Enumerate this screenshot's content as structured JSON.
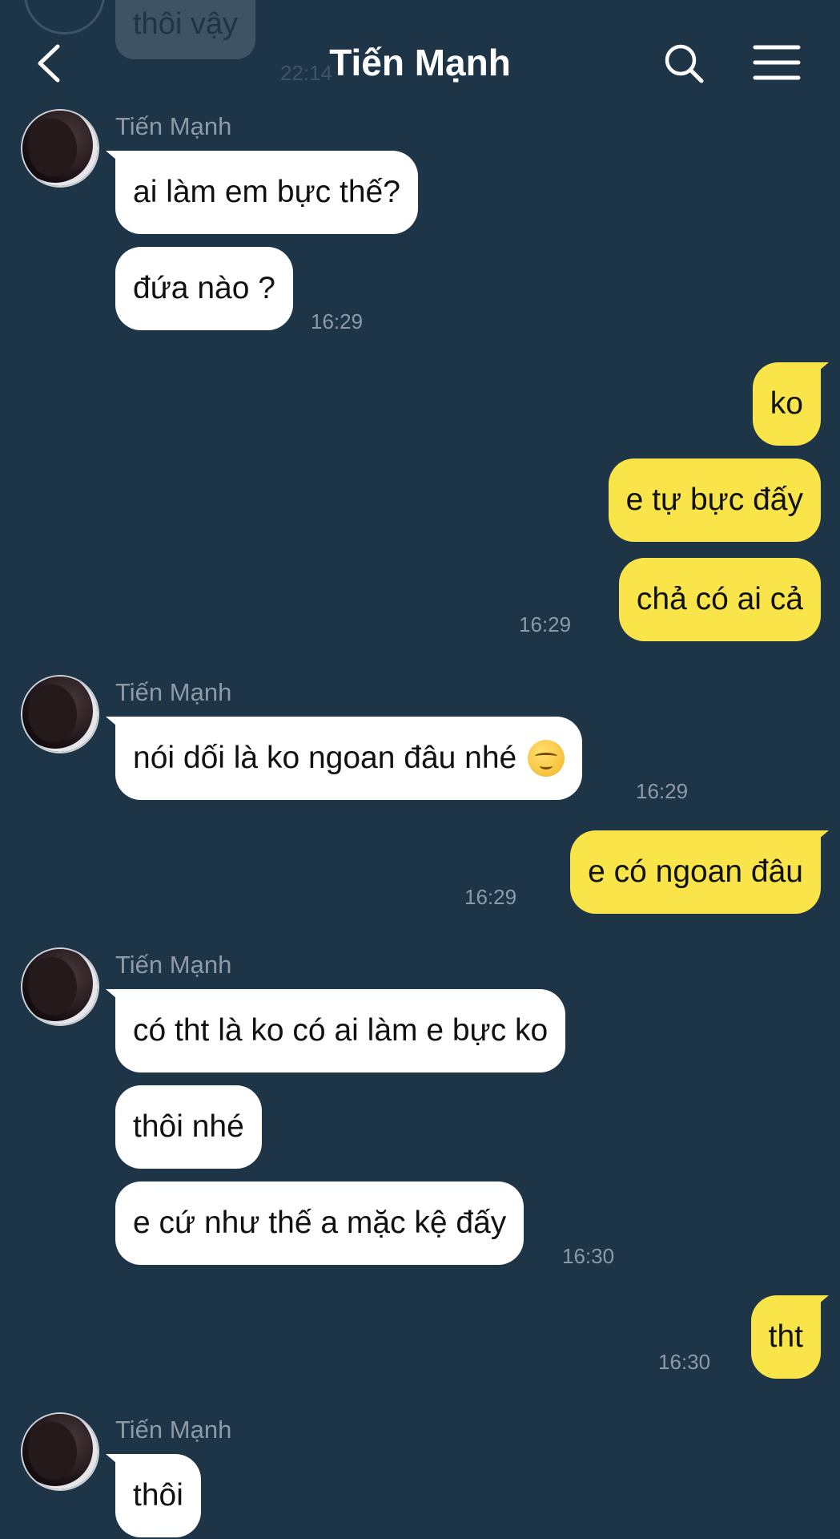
{
  "header": {
    "title": "Tiến Mạnh",
    "back_icon": "chevron-left-icon",
    "search_icon": "search-icon",
    "menu_icon": "hamburger-menu-icon"
  },
  "faded_top": {
    "text": "thôi vậy",
    "time": "22:14"
  },
  "colors": {
    "background": "#1e3447",
    "incoming_bubble": "#ffffff",
    "outgoing_bubble": "#f9e44a",
    "meta_text": "#8e9aa6"
  },
  "messages": [
    {
      "direction": "incoming",
      "sender": "Tiến Mạnh",
      "bubbles": [
        "ai làm em bực thế?",
        "đứa nào ?"
      ],
      "time": "16:29"
    },
    {
      "direction": "outgoing",
      "bubbles": [
        "ko",
        "e tự bực đấy",
        "chả có ai cả"
      ],
      "time": "16:29"
    },
    {
      "direction": "incoming",
      "sender": "Tiến Mạnh",
      "bubbles": [
        "nói dối là ko ngoan đâu nhé"
      ],
      "emoji": "relieved-face-emoji",
      "time": "16:29"
    },
    {
      "direction": "outgoing",
      "bubbles": [
        "e có ngoan đâu"
      ],
      "time": "16:29"
    },
    {
      "direction": "incoming",
      "sender": "Tiến Mạnh",
      "bubbles": [
        "có tht là ko có ai làm e bực ko",
        "thôi nhé",
        "e cứ như thế a mặc kệ đấy"
      ],
      "time": "16:30"
    },
    {
      "direction": "outgoing",
      "bubbles": [
        "tht"
      ],
      "time": "16:30"
    },
    {
      "direction": "incoming",
      "sender": "Tiến Mạnh",
      "bubbles": [
        "thôi"
      ]
    }
  ]
}
